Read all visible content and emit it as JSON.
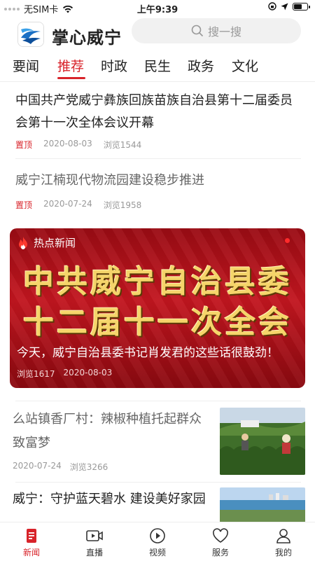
{
  "status": {
    "carrier": "无SIM卡",
    "time": "上午9:39"
  },
  "header": {
    "app_title": "掌心威宁",
    "search_placeholder": "搜一搜"
  },
  "tabs": [
    {
      "label": "要闻"
    },
    {
      "label": "推荐"
    },
    {
      "label": "时政"
    },
    {
      "label": "民生"
    },
    {
      "label": "政务"
    },
    {
      "label": "文化"
    }
  ],
  "active_tab": "推荐",
  "articles": [
    {
      "title": "中国共产党威宁彝族回族苗族自治县第十二届委员会第十一次全体会议开幕",
      "pin": "置顶",
      "date": "2020-08-03",
      "views": "浏览1544"
    },
    {
      "title": "威宁江楠现代物流园建设稳步推进",
      "pin": "置顶",
      "date": "2020-07-24",
      "views": "浏览1958"
    }
  ],
  "hot": {
    "label": "热点新闻",
    "banner_line1": "中共威宁自治县委",
    "banner_line2": "十二届十一次全会",
    "headline": "今天，威宁自治县委书记肖发君的这些话很鼓劲！",
    "views": "浏览1617",
    "date": "2020-08-03"
  },
  "feed": [
    {
      "title": "么站镇香厂村：辣椒种植托起群众致富梦",
      "date": "2020-07-24",
      "views": "浏览3266"
    },
    {
      "title": "威宁：守护蓝天碧水 建设美好家园"
    }
  ],
  "nav": [
    {
      "label": "新闻",
      "icon": "news-icon"
    },
    {
      "label": "直播",
      "icon": "live-icon"
    },
    {
      "label": "视频",
      "icon": "play-icon"
    },
    {
      "label": "服务",
      "icon": "heart-icon"
    },
    {
      "label": "我的",
      "icon": "user-icon"
    }
  ],
  "colors": {
    "accent": "#d8232a"
  }
}
